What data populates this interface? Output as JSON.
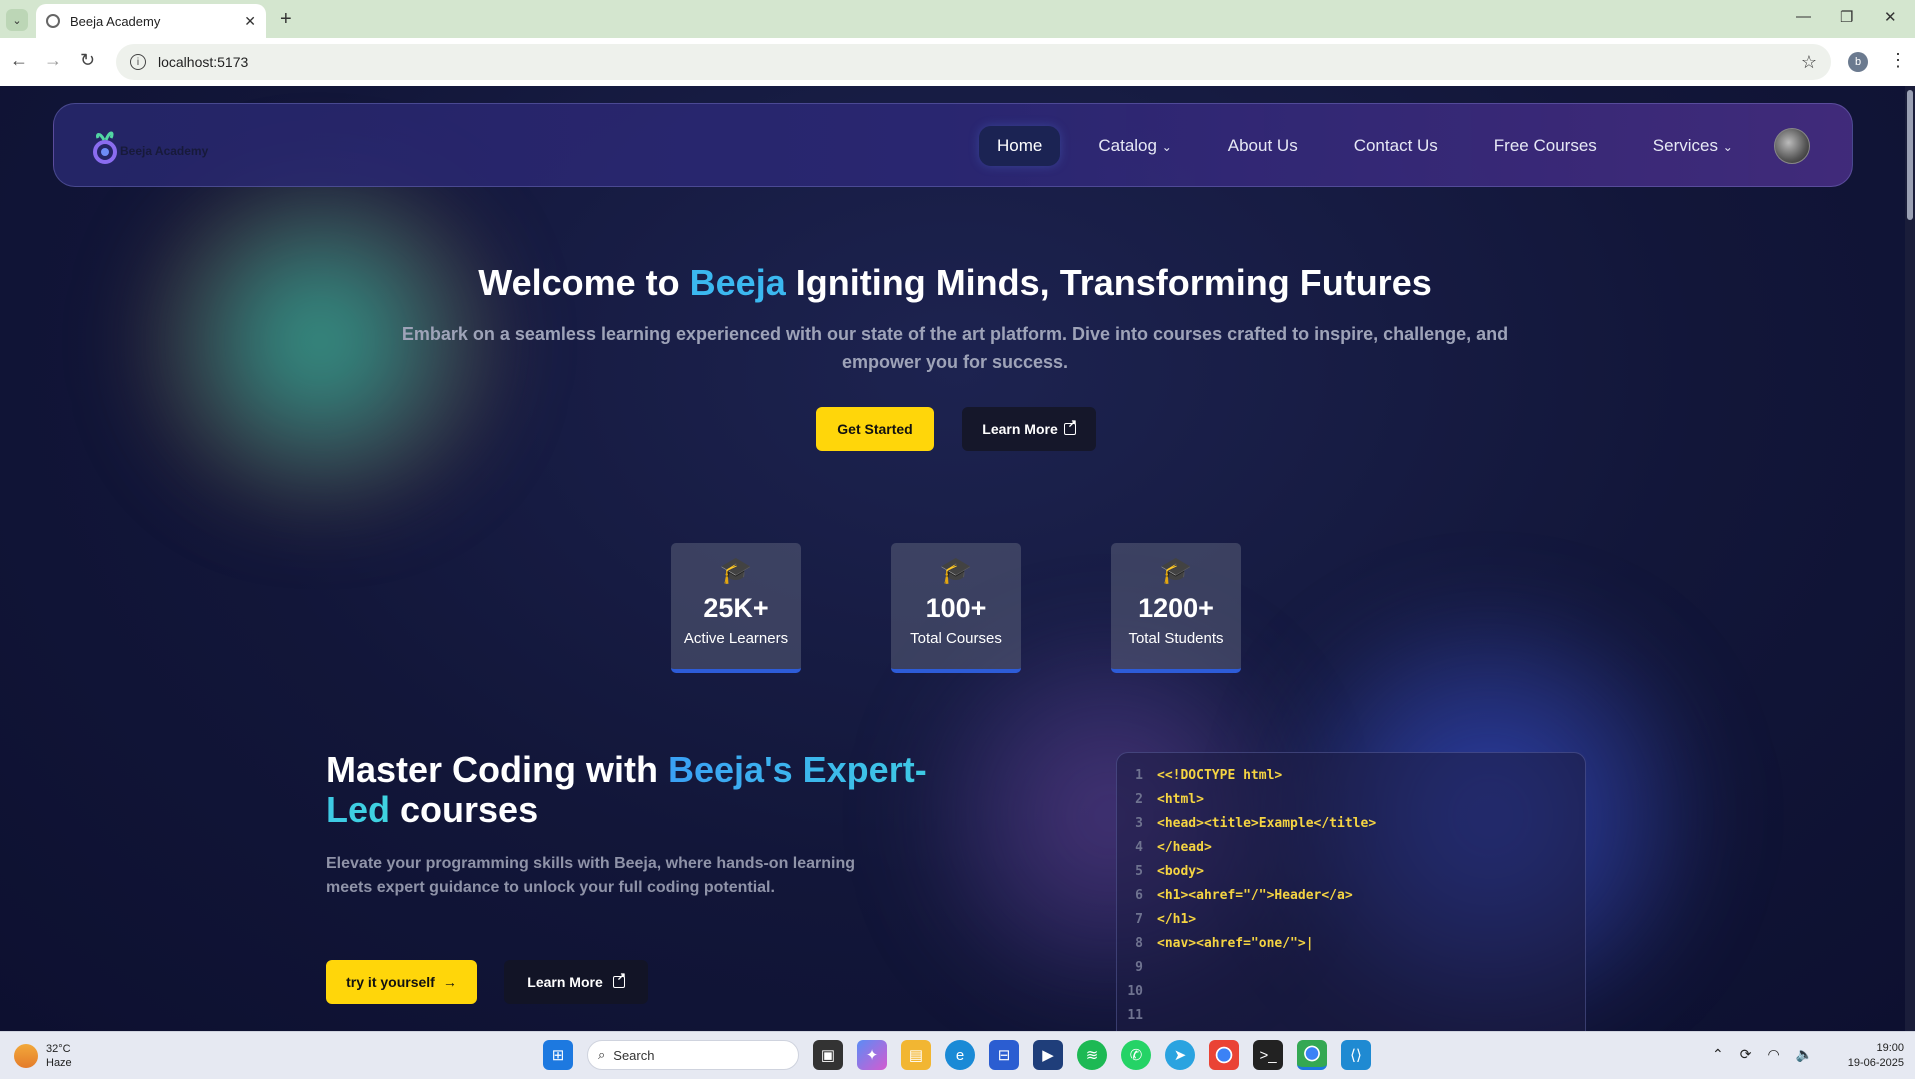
{
  "browser": {
    "tab_title": "Beeja Academy",
    "url": "localhost:5173",
    "profile_initial": "b"
  },
  "navbar": {
    "logo_text": "Beeja Academy",
    "items": [
      {
        "label": "Home",
        "active": true
      },
      {
        "label": "Catalog",
        "dropdown": true
      },
      {
        "label": "About Us"
      },
      {
        "label": "Contact Us"
      },
      {
        "label": "Free Courses"
      },
      {
        "label": "Services",
        "dropdown": true
      }
    ]
  },
  "hero": {
    "title_prefix": "Welcome to ",
    "title_highlight": "Beeja",
    "title_suffix": " Igniting Minds, Transforming Futures",
    "subtitle": "Embark on a seamless learning experienced with our state of the art platform. Dive into courses crafted to inspire, challenge, and empower you for success.",
    "primary_button": "Get Started",
    "secondary_button": "Learn More"
  },
  "stats": [
    {
      "value": "25K+",
      "label": "Active Learners",
      "icon": "graduation-cap-icon"
    },
    {
      "value": "100+",
      "label": "Total Courses",
      "icon": "graduation-cap-icon"
    },
    {
      "value": "1200+",
      "label": "Total Students",
      "icon": "graduation-cap-icon"
    }
  ],
  "coding": {
    "title_prefix": "Master Coding with ",
    "title_highlight": "Beeja's Expert-Led",
    "title_suffix": " courses",
    "subtitle": "Elevate your programming skills with Beeja, where hands-on learning meets expert guidance to unlock your full coding potential.",
    "primary_button": "try it yourself",
    "secondary_button": "Learn More",
    "code_lines": [
      {
        "n": "1",
        "code": "<<!DOCTYPE html>"
      },
      {
        "n": "2",
        "code": "<html>"
      },
      {
        "n": "3",
        "code": "<head><title>Example</title>"
      },
      {
        "n": "4",
        "code": "</head>"
      },
      {
        "n": "5",
        "code": "<body>"
      },
      {
        "n": "6",
        "code": "<h1><ahref=\"/\">Header</a>"
      },
      {
        "n": "7",
        "code": "</h1>"
      },
      {
        "n": "8",
        "code": "<nav><ahref=\"one/\">|"
      },
      {
        "n": "9",
        "code": ""
      },
      {
        "n": "10",
        "code": ""
      },
      {
        "n": "11",
        "code": ""
      }
    ]
  },
  "taskbar": {
    "temperature": "32°C",
    "weather": "Haze",
    "search_placeholder": "Search",
    "time": "19:00",
    "date": "19-06-2025"
  },
  "colors": {
    "accent_yellow": "#ffd60a",
    "accent_blue": "#3bb8f0",
    "page_bg": "#121639"
  }
}
